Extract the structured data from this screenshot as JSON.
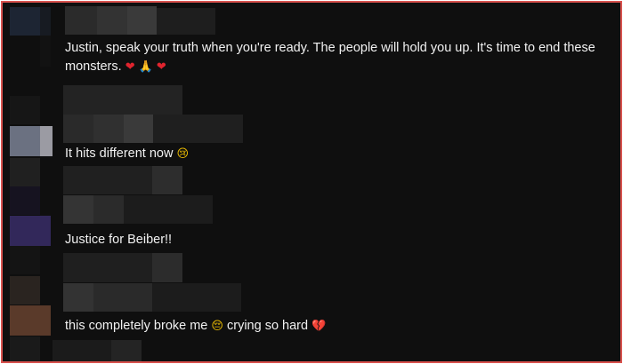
{
  "comments": [
    {
      "text": "Justin, speak your truth when you're ready. The people will hold you up. It's time to end these monsters.",
      "emojis": [
        "heart-icon",
        "praying-hands-icon",
        "heart-icon"
      ]
    },
    {
      "text": "It hits different now",
      "emojis": [
        "crying-face-icon"
      ]
    },
    {
      "text": "Justice for Beiber!!",
      "emojis": []
    },
    {
      "text_before": "this completely broke me",
      "text_after": "crying so hard",
      "emojis": [
        "pensive-face-icon",
        "broken-heart-icon"
      ]
    }
  ],
  "glyphs": {
    "heart": "❤",
    "praying": "🙏",
    "crying": "😢",
    "pensive": "😔",
    "broken_heart": "💔"
  }
}
